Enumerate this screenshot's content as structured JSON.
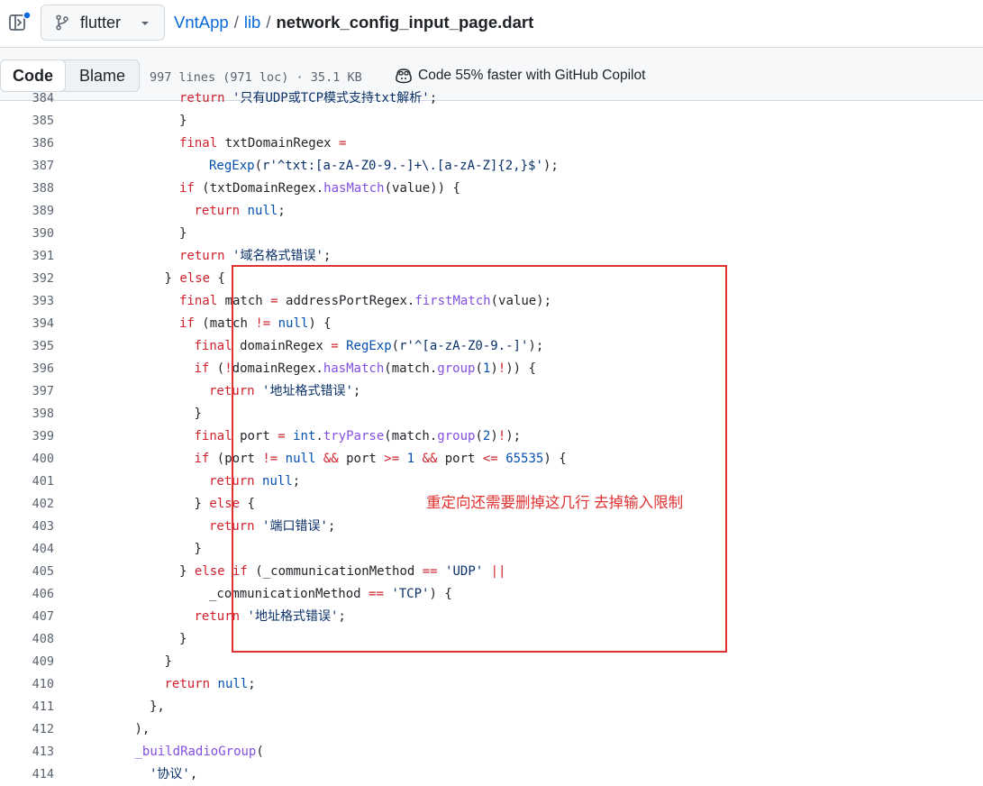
{
  "header": {
    "branch": "flutter",
    "crumbs": {
      "repo": "VntApp",
      "sep": "/",
      "dir": "lib",
      "file": "network_config_input_page.dart"
    }
  },
  "filebar": {
    "tabs": {
      "code": "Code",
      "blame": "Blame"
    },
    "meta": "997 lines (971 loc) · 35.1 KB",
    "copilot": "Code 55% faster with GitHub Copilot"
  },
  "annotation": {
    "note": "重定向还需要删掉这几行 去掉输入限制",
    "color": "#e03131"
  },
  "colors": {
    "keyword": "#cf222e",
    "function": "#8250df",
    "type": "#0550ae",
    "string": "#0a3069",
    "link": "#0969da"
  },
  "code": {
    "lines": [
      {
        "n": "384",
        "ind": 6,
        "t": [
          [
            "kw",
            "return "
          ],
          [
            "str",
            "'只有UDP或TCP模式支持txt解析'"
          ],
          [
            "pl",
            ";"
          ]
        ]
      },
      {
        "n": "385",
        "ind": 6,
        "t": [
          [
            "pl",
            "}"
          ]
        ]
      },
      {
        "n": "386",
        "ind": 6,
        "t": [
          [
            "kw",
            "final "
          ],
          [
            "pl",
            "txtDomainRegex "
          ],
          [
            "op",
            "="
          ]
        ]
      },
      {
        "n": "387",
        "ind": 8,
        "t": [
          [
            "ty",
            "RegExp"
          ],
          [
            "pl",
            "("
          ],
          [
            "str",
            "r'^txt:[a-zA-Z0-9.-]+\\.[a-zA-Z]{2,}$'"
          ],
          [
            "pl",
            ");"
          ]
        ]
      },
      {
        "n": "388",
        "ind": 6,
        "t": [
          [
            "kw",
            "if "
          ],
          [
            "pl",
            "(txtDomainRegex."
          ],
          [
            "fn",
            "hasMatch"
          ],
          [
            "pl",
            "(value)) {"
          ]
        ]
      },
      {
        "n": "389",
        "ind": 7,
        "t": [
          [
            "kw",
            "return "
          ],
          [
            "ty",
            "null"
          ],
          [
            "pl",
            ";"
          ]
        ]
      },
      {
        "n": "390",
        "ind": 6,
        "t": [
          [
            "pl",
            "}"
          ]
        ]
      },
      {
        "n": "391",
        "ind": 6,
        "t": [
          [
            "kw",
            "return "
          ],
          [
            "str",
            "'域名格式错误'"
          ],
          [
            "pl",
            ";"
          ]
        ]
      },
      {
        "n": "392",
        "ind": 5,
        "t": [
          [
            "pl",
            "} "
          ],
          [
            "kw",
            "else "
          ],
          [
            "pl",
            "{"
          ]
        ]
      },
      {
        "n": "393",
        "ind": 6,
        "t": [
          [
            "kw",
            "final "
          ],
          [
            "pl",
            "match "
          ],
          [
            "op",
            "= "
          ],
          [
            "pl",
            "addressPortRegex."
          ],
          [
            "fn",
            "firstMatch"
          ],
          [
            "pl",
            "(value);"
          ]
        ]
      },
      {
        "n": "394",
        "ind": 6,
        "t": [
          [
            "kw",
            "if "
          ],
          [
            "pl",
            "(match "
          ],
          [
            "op",
            "!= "
          ],
          [
            "ty",
            "null"
          ],
          [
            "pl",
            ") {"
          ]
        ]
      },
      {
        "n": "395",
        "ind": 7,
        "t": [
          [
            "kw",
            "final "
          ],
          [
            "pl",
            "domainRegex "
          ],
          [
            "op",
            "= "
          ],
          [
            "ty",
            "RegExp"
          ],
          [
            "pl",
            "("
          ],
          [
            "str",
            "r'^[a-zA-Z0-9.-]'"
          ],
          [
            "pl",
            ");"
          ]
        ]
      },
      {
        "n": "396",
        "ind": 7,
        "t": [
          [
            "kw",
            "if "
          ],
          [
            "pl",
            "("
          ],
          [
            "op",
            "!"
          ],
          [
            "pl",
            "domainRegex."
          ],
          [
            "fn",
            "hasMatch"
          ],
          [
            "pl",
            "(match."
          ],
          [
            "fn",
            "group"
          ],
          [
            "pl",
            "("
          ],
          [
            "num",
            "1"
          ],
          [
            "pl",
            ")"
          ],
          [
            "op",
            "!"
          ],
          [
            "pl",
            ")) {"
          ]
        ]
      },
      {
        "n": "397",
        "ind": 8,
        "t": [
          [
            "kw",
            "return "
          ],
          [
            "str",
            "'地址格式错误'"
          ],
          [
            "pl",
            ";"
          ]
        ]
      },
      {
        "n": "398",
        "ind": 7,
        "t": [
          [
            "pl",
            "}"
          ]
        ]
      },
      {
        "n": "399",
        "ind": 7,
        "t": [
          [
            "kw",
            "final "
          ],
          [
            "pl",
            "port "
          ],
          [
            "op",
            "= "
          ],
          [
            "ty",
            "int"
          ],
          [
            "pl",
            "."
          ],
          [
            "fn",
            "tryParse"
          ],
          [
            "pl",
            "(match."
          ],
          [
            "fn",
            "group"
          ],
          [
            "pl",
            "("
          ],
          [
            "num",
            "2"
          ],
          [
            "pl",
            ")"
          ],
          [
            "op",
            "!"
          ],
          [
            "pl",
            ");"
          ]
        ]
      },
      {
        "n": "400",
        "ind": 7,
        "t": [
          [
            "kw",
            "if "
          ],
          [
            "pl",
            "(port "
          ],
          [
            "op",
            "!= "
          ],
          [
            "ty",
            "null "
          ],
          [
            "op",
            "&& "
          ],
          [
            "pl",
            "port "
          ],
          [
            "op",
            ">= "
          ],
          [
            "num",
            "1 "
          ],
          [
            "op",
            "&& "
          ],
          [
            "pl",
            "port "
          ],
          [
            "op",
            "<= "
          ],
          [
            "num",
            "65535"
          ],
          [
            "pl",
            ") {"
          ]
        ]
      },
      {
        "n": "401",
        "ind": 8,
        "t": [
          [
            "kw",
            "return "
          ],
          [
            "ty",
            "null"
          ],
          [
            "pl",
            ";"
          ]
        ]
      },
      {
        "n": "402",
        "ind": 7,
        "t": [
          [
            "pl",
            "} "
          ],
          [
            "kw",
            "else "
          ],
          [
            "pl",
            "{"
          ]
        ]
      },
      {
        "n": "403",
        "ind": 8,
        "t": [
          [
            "kw",
            "return "
          ],
          [
            "str",
            "'端口错误'"
          ],
          [
            "pl",
            ";"
          ]
        ]
      },
      {
        "n": "404",
        "ind": 7,
        "t": [
          [
            "pl",
            "}"
          ]
        ]
      },
      {
        "n": "405",
        "ind": 6,
        "t": [
          [
            "pl",
            "} "
          ],
          [
            "kw",
            "else if "
          ],
          [
            "pl",
            "(_communicationMethod "
          ],
          [
            "op",
            "== "
          ],
          [
            "str",
            "'UDP' "
          ],
          [
            "op",
            "||"
          ]
        ]
      },
      {
        "n": "406",
        "ind": 8,
        "t": [
          [
            "pl",
            "_communicationMethod "
          ],
          [
            "op",
            "== "
          ],
          [
            "str",
            "'TCP'"
          ],
          [
            "pl",
            ") {"
          ]
        ]
      },
      {
        "n": "407",
        "ind": 7,
        "t": [
          [
            "kw",
            "return "
          ],
          [
            "str",
            "'地址格式错误'"
          ],
          [
            "pl",
            ";"
          ]
        ]
      },
      {
        "n": "408",
        "ind": 6,
        "t": [
          [
            "pl",
            "}"
          ]
        ]
      },
      {
        "n": "409",
        "ind": 5,
        "t": [
          [
            "pl",
            "}"
          ]
        ]
      },
      {
        "n": "410",
        "ind": 5,
        "t": [
          [
            "kw",
            "return "
          ],
          [
            "ty",
            "null"
          ],
          [
            "pl",
            ";"
          ]
        ]
      },
      {
        "n": "411",
        "ind": 4,
        "t": [
          [
            "pl",
            "},"
          ]
        ]
      },
      {
        "n": "412",
        "ind": 3,
        "t": [
          [
            "pl",
            "),"
          ]
        ]
      },
      {
        "n": "413",
        "ind": 3,
        "t": [
          [
            "fn",
            "_buildRadioGroup"
          ],
          [
            "pl",
            "("
          ]
        ]
      },
      {
        "n": "414",
        "ind": 4,
        "t": [
          [
            "str",
            "'协议'"
          ],
          [
            "pl",
            ","
          ]
        ]
      }
    ]
  }
}
